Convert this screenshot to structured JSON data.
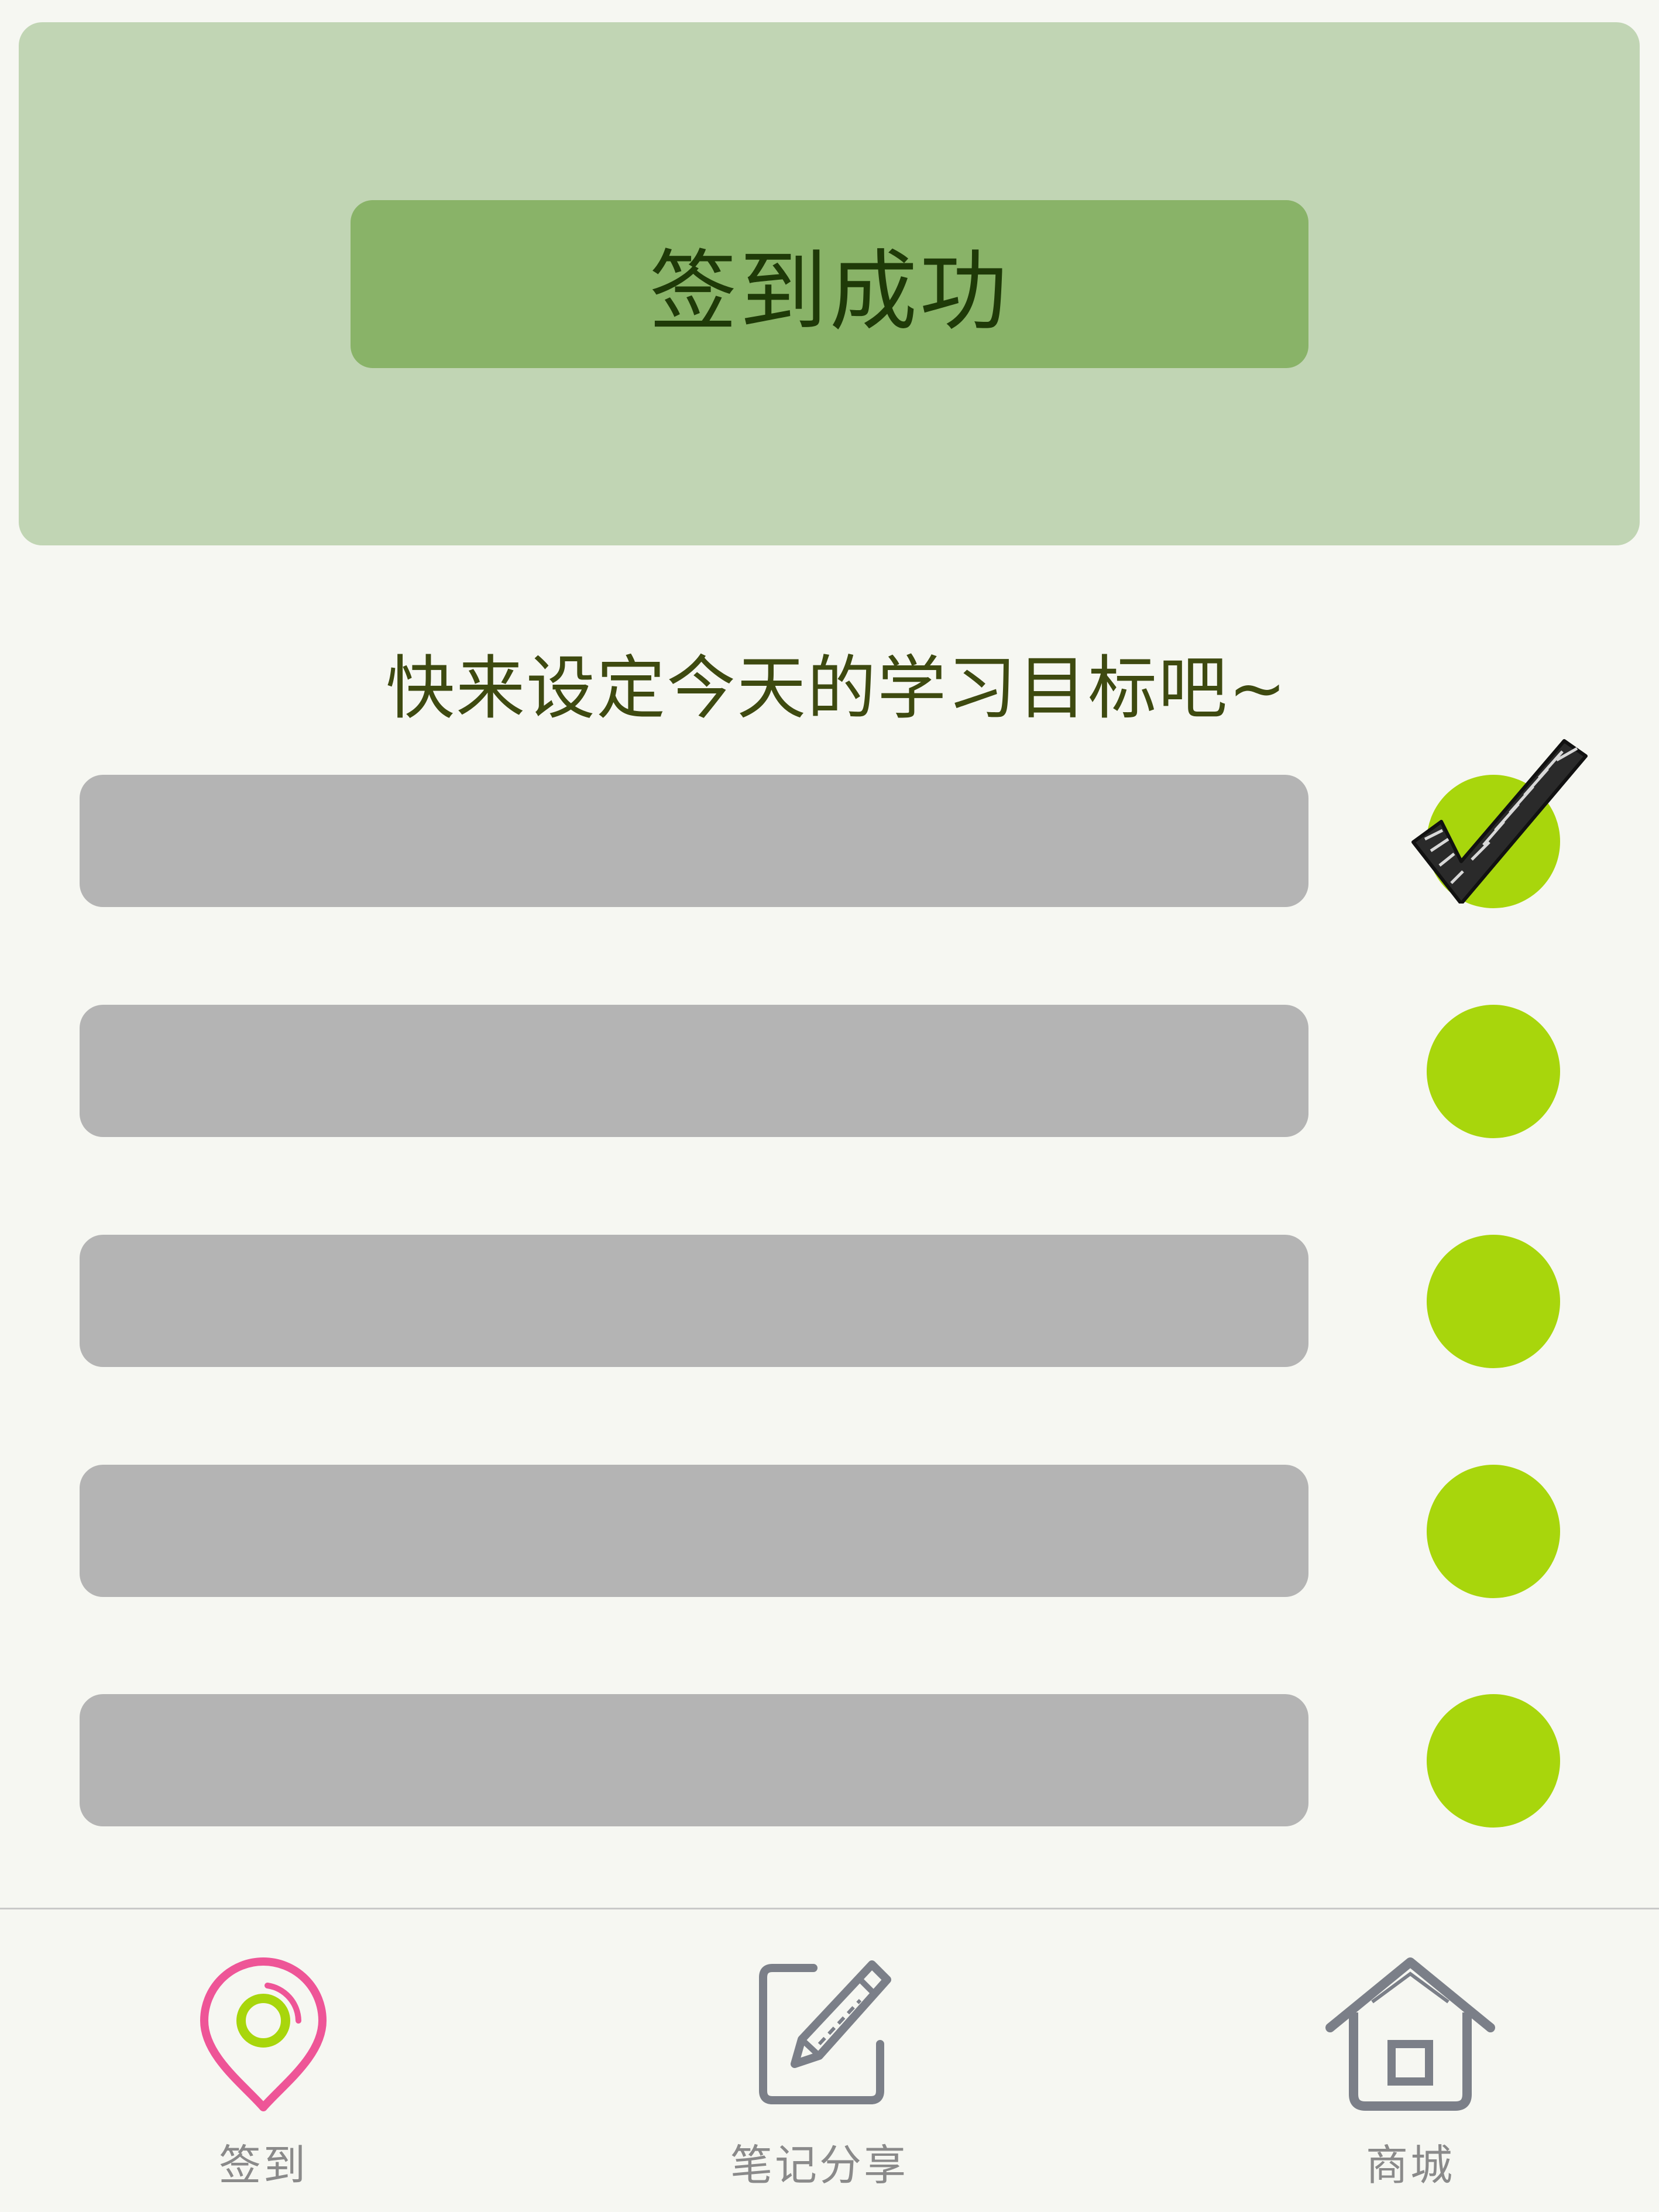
{
  "header": {
    "status_text": "签到成功"
  },
  "prompt": {
    "text": "快来设定今天的学习目标吧~"
  },
  "goals": [
    {
      "text": "",
      "checked": true
    },
    {
      "text": "",
      "checked": false
    },
    {
      "text": "",
      "checked": false
    },
    {
      "text": "",
      "checked": false
    },
    {
      "text": "",
      "checked": false
    }
  ],
  "nav": {
    "items": [
      {
        "label": "签到",
        "icon": "location-pin-icon",
        "active": true
      },
      {
        "label": "笔记分享",
        "icon": "edit-note-icon",
        "active": false
      },
      {
        "label": "商城",
        "icon": "home-icon",
        "active": false
      }
    ]
  },
  "colors": {
    "header_panel": "#c1d5b4",
    "banner": "#89b368",
    "goal_bar": "#b4b4b4",
    "goal_dot": "#a8d60c",
    "active_icon": "#ee5597",
    "inactive_icon": "#7b7f88"
  }
}
